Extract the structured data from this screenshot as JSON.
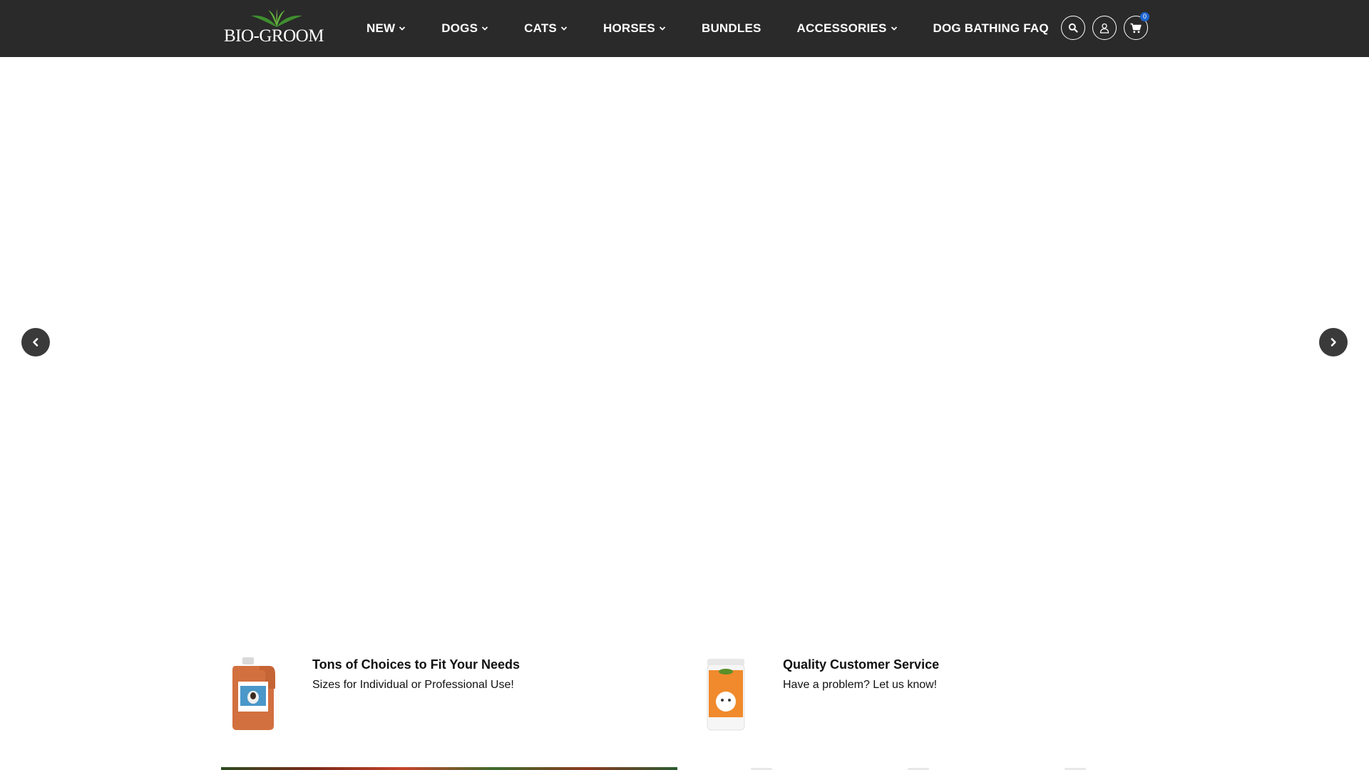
{
  "brand": {
    "name": "BIO-GROOM"
  },
  "nav": {
    "items": [
      {
        "label": "NEW",
        "has_dropdown": true
      },
      {
        "label": "DOGS",
        "has_dropdown": true
      },
      {
        "label": "CATS",
        "has_dropdown": true
      },
      {
        "label": "HORSES",
        "has_dropdown": true
      },
      {
        "label": "BUNDLES",
        "has_dropdown": false
      },
      {
        "label": "ACCESSORIES",
        "has_dropdown": true
      },
      {
        "label": "DOG BATHING FAQ",
        "has_dropdown": false
      }
    ]
  },
  "header_icons": {
    "search": "search-icon",
    "account": "user-icon",
    "cart": "cart-icon",
    "cart_count": "0"
  },
  "carousel": {
    "prev_icon": "chevron-left-icon",
    "next_icon": "chevron-right-icon"
  },
  "features": [
    {
      "title": "Tons of Choices to Fit Your Needs",
      "subtitle": "Sizes for Individual or Professional Use!"
    },
    {
      "title": "Quality Customer Service",
      "subtitle": "Have a problem? Let us know!"
    }
  ],
  "colors": {
    "header_bg": "#2a2a2a",
    "badge": "#1e66d0",
    "arrow_bg": "#3a3a3a"
  }
}
